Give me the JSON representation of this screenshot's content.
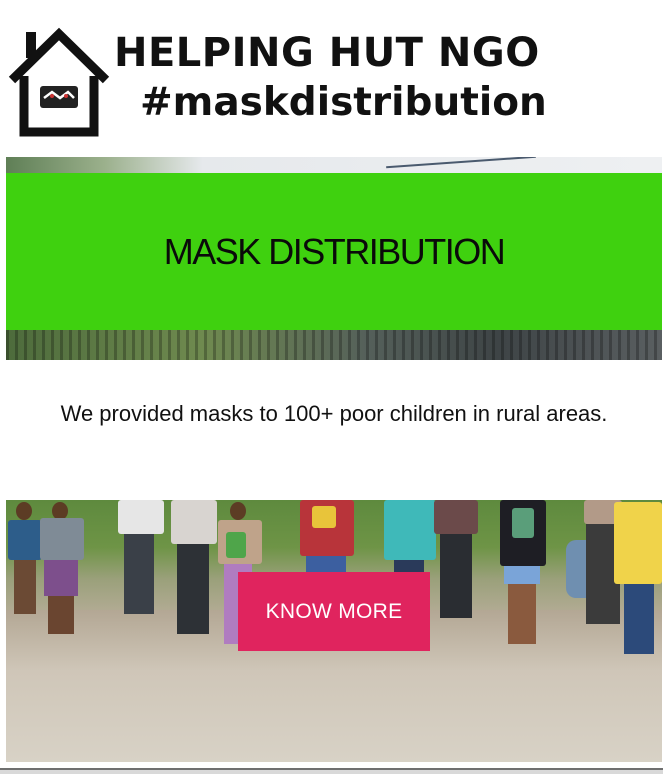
{
  "header": {
    "logo": {
      "icon": "house-handshake-logo",
      "text": "HELPING HUT"
    },
    "title": "HELPING HUT NGO",
    "hashtag": "#maskdistribution"
  },
  "hero": {
    "title": "MASK DISTRIBUTION",
    "band_color": "#3fd10f"
  },
  "description": "We provided masks to 100+ poor children in rural areas.",
  "photo_section": {
    "button_label": "KNOW MORE",
    "button_color": "#e0245e"
  }
}
